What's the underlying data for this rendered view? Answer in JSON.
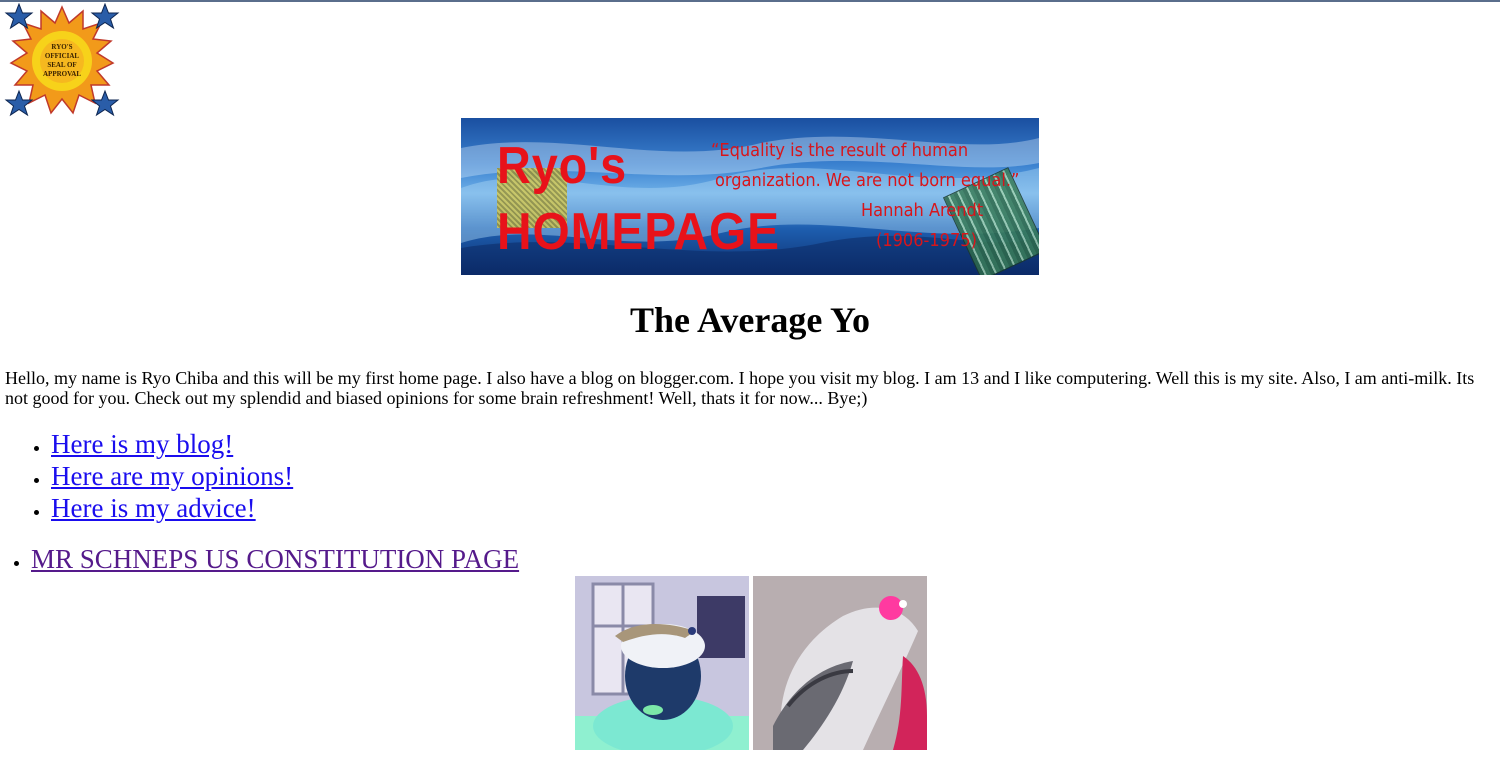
{
  "seal": {
    "lines": [
      "RYO'S",
      "OFFICIAL",
      "SEAL OF",
      "APPROVAL"
    ]
  },
  "banner": {
    "title_line1": "Ryo's",
    "title_line2": "HOMEPAGE",
    "quote_line1": "“Equality is the result of human",
    "quote_line2": "organization. We are not born equal.”",
    "quote_line3": "Hannah Arendt",
    "quote_line4": "(1906-1975)"
  },
  "page": {
    "title": "The Average Yo",
    "intro": "Hello, my name is Ryo Chiba and this will be my first home page. I also have a blog on blogger.com. I hope you visit my blog. I am 13 and I like computering. Well this is my site. Also, I am anti-milk. Its not good for you. Check out my splendid and biased opinions for some brain refreshment! Well, thats it for now... Bye;)"
  },
  "nav": {
    "links": [
      {
        "label": "Here is my blog!"
      },
      {
        "label": "Here are my opinions!"
      },
      {
        "label": "Here is my advice!"
      }
    ],
    "extra_link": "MR SCHNEPS US CONSTITUTION PAGE"
  },
  "colors": {
    "link": "#1a0dee",
    "visited_link": "#551a8b",
    "banner_text": "#e8121a"
  }
}
